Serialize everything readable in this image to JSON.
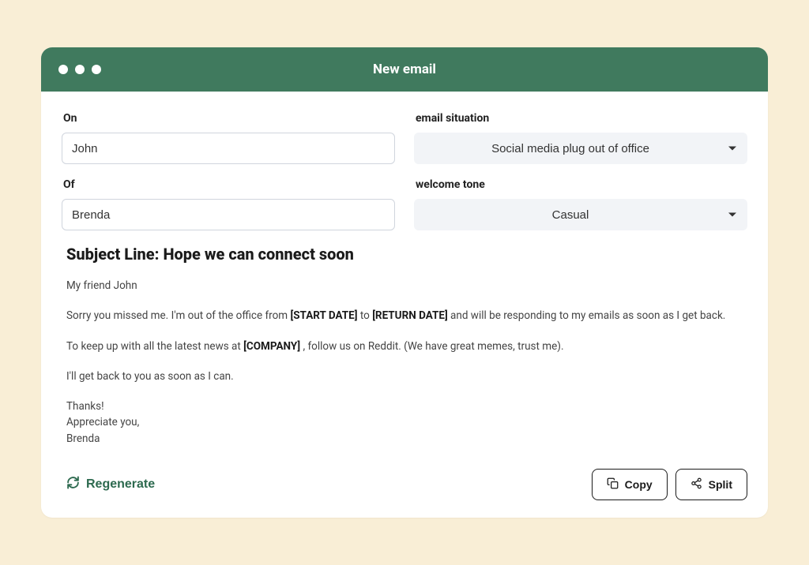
{
  "window": {
    "title": "New email"
  },
  "form": {
    "on": {
      "label": "On",
      "value": "John"
    },
    "of": {
      "label": "Of",
      "value": "Brenda"
    },
    "situation": {
      "label": "email situation",
      "selected": "Social media plug out of office"
    },
    "tone": {
      "label": "welcome tone",
      "selected": "Casual"
    }
  },
  "email": {
    "subject_prefix": "Subject Line: ",
    "subject": "Hope we can connect soon",
    "greeting": "My friend John",
    "p1_a": "Sorry you missed me. I'm out of the office from ",
    "p1_start_date": "[START DATE]",
    "p1_b": " to ",
    "p1_return_date": "[RETURN DATE]",
    "p1_c": " and will be responding to my emails as soon as I get back.",
    "p2_a": "To keep up with all the latest news at ",
    "p2_company": "[COMPANY]",
    "p2_b": " , follow us on Reddit. (We have great memes, trust me).",
    "p3": "I'll get back to you as soon as I can.",
    "sig1": "Thanks!",
    "sig2": "Appreciate you,",
    "sig3": "Brenda"
  },
  "actions": {
    "regenerate": "Regenerate",
    "copy": "Copy",
    "split": "Split"
  },
  "colors": {
    "accent": "#407a5e",
    "regen_text": "#2d6a4f",
    "page_bg": "#f9eed6",
    "select_bg": "#f2f4f7"
  }
}
